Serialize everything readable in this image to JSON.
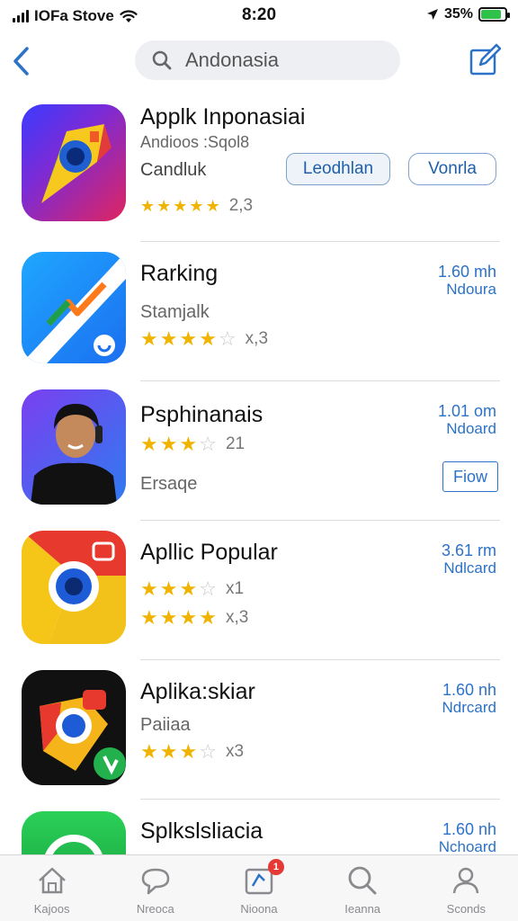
{
  "status_bar": {
    "carrier": "IOFa Stove",
    "time": "8:20",
    "battery_percent": "35%",
    "battery_level": 0.85
  },
  "nav": {
    "search_value": "Andonasia"
  },
  "apps": [
    {
      "title": "Applk Inponasiai",
      "subtitle": "Andioos :Sqol8",
      "subtitle2": "Candluk",
      "rating_count": "2,3",
      "stars": 5,
      "buttons": [
        "Leodhlan",
        "Vonrla"
      ]
    },
    {
      "title": "Rarking",
      "subtitle": "Stamjalk",
      "rating_count": "x,3",
      "stars": 4,
      "size": "1.60 mh",
      "size_label": "Ndoura"
    },
    {
      "title": "Psphinanais",
      "rating_count": "21",
      "subtitle": "Ersaqe",
      "stars": 3,
      "size": "1.01 om",
      "size_label": "Ndoard",
      "button": "Fiow"
    },
    {
      "title": "Apllic Popular",
      "rating_count": "x1",
      "rating_count2": "x,3",
      "stars": 3,
      "stars2": 4,
      "size": "3.61 rm",
      "size_label": "Ndlcard"
    },
    {
      "title": "Aplika:skiar",
      "subtitle": "Paiiaa",
      "rating_count": "x3",
      "stars": 3,
      "size": "1.60 nh",
      "size_label": "Ndrcard"
    },
    {
      "title": "Splkslsliacia",
      "size": "1.60 nh",
      "size_label": "Nchoard"
    }
  ],
  "tabs": [
    {
      "label": "Kajoos",
      "icon": "home-icon"
    },
    {
      "label": "Nreoca",
      "icon": "chat-icon"
    },
    {
      "label": "Nioona",
      "icon": "updates-icon",
      "badge": "1"
    },
    {
      "label": "Ieanna",
      "icon": "search-icon"
    },
    {
      "label": "Sconds",
      "icon": "profile-icon"
    }
  ],
  "colors": {
    "accent": "#2b72c8",
    "star": "#f0b400",
    "badge": "#e53935"
  }
}
